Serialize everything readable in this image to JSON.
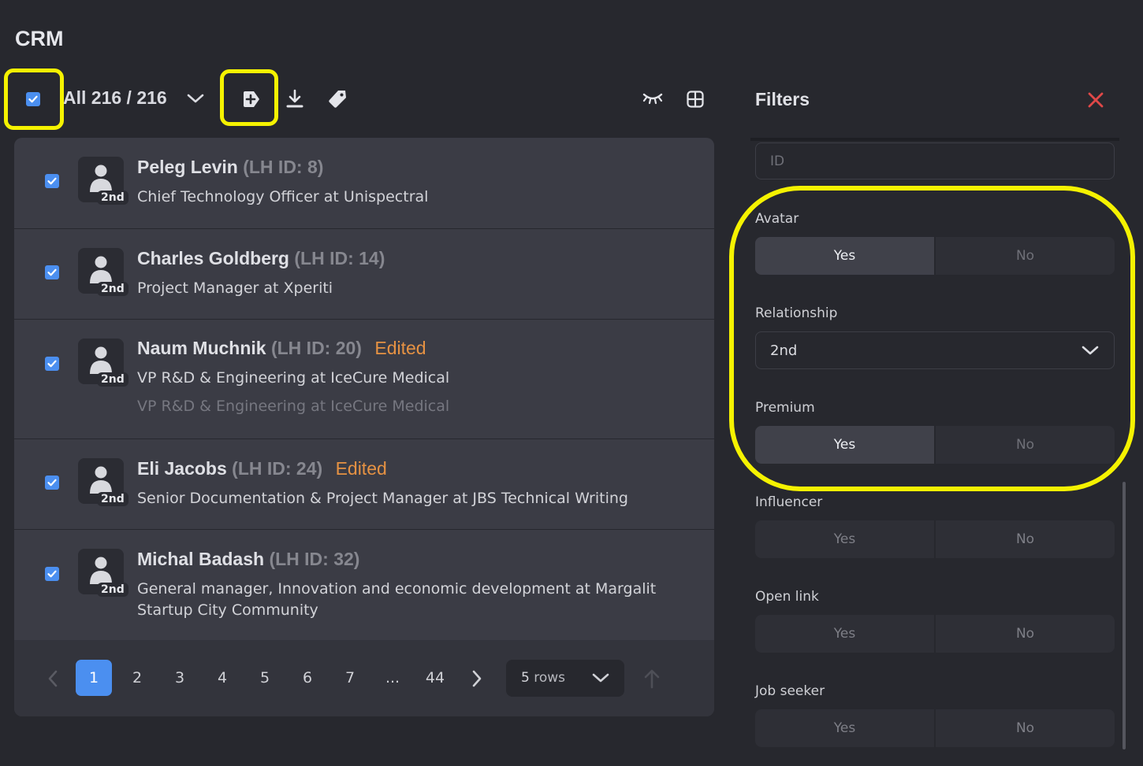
{
  "app_title": "CRM",
  "toolbar": {
    "count_label": "All 216 / 216"
  },
  "contacts": [
    {
      "name": "Peleg Levin",
      "lhid": "(LH ID: 8)",
      "degree": "2nd",
      "job": "Chief Technology Officer at Unispectral",
      "edited": "",
      "job_old": ""
    },
    {
      "name": "Charles Goldberg",
      "lhid": "(LH ID: 14)",
      "degree": "2nd",
      "job": "Project Manager at Xperiti",
      "edited": "",
      "job_old": ""
    },
    {
      "name": "Naum Muchnik",
      "lhid": "(LH ID: 20)",
      "degree": "2nd",
      "job": "VP R&D & Engineering at IceCure Medical",
      "edited": "Edited",
      "job_old": "VP R&D & Engineering at IceCure Medical"
    },
    {
      "name": "Eli Jacobs",
      "lhid": "(LH ID: 24)",
      "degree": "2nd",
      "job": "Senior Documentation & Project Manager at JBS Technical Writing",
      "edited": "Edited",
      "job_old": ""
    },
    {
      "name": "Michal Badash",
      "lhid": "(LH ID: 32)",
      "degree": "2nd",
      "job": "General manager, Innovation and economic development at Margalit Startup City Community",
      "edited": "",
      "job_old": ""
    }
  ],
  "pagination": {
    "pages": [
      "1",
      "2",
      "3",
      "4",
      "5",
      "6",
      "7",
      "...",
      "44"
    ],
    "active": "1",
    "rows_value": "5",
    "rows_label": "rows"
  },
  "filters": {
    "title": "Filters",
    "id_placeholder": "ID",
    "avatar": {
      "label": "Avatar",
      "yes": "Yes",
      "no": "No",
      "selected": "Yes"
    },
    "relationship": {
      "label": "Relationship",
      "value": "2nd"
    },
    "premium": {
      "label": "Premium",
      "yes": "Yes",
      "no": "No",
      "selected": "Yes"
    },
    "influencer": {
      "label": "Influencer",
      "yes": "Yes",
      "no": "No"
    },
    "open_link": {
      "label": "Open link",
      "yes": "Yes",
      "no": "No"
    },
    "job_seeker": {
      "label": "Job seeker",
      "yes": "Yes",
      "no": "No"
    }
  },
  "colors": {
    "accent": "#4b8ff0",
    "edited": "#e69243",
    "highlight": "#f5f200",
    "close": "#e04848"
  }
}
